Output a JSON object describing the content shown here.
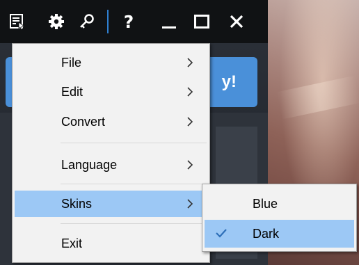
{
  "main_menu": {
    "items": [
      {
        "label": "File",
        "has_submenu": true
      },
      {
        "label": "Edit",
        "has_submenu": true
      },
      {
        "label": "Convert",
        "has_submenu": true
      },
      {
        "label": "Language",
        "has_submenu": true
      },
      {
        "label": "Skins",
        "has_submenu": true,
        "highlighted": true
      },
      {
        "label": "Exit",
        "has_submenu": false
      }
    ]
  },
  "skins_submenu": {
    "items": [
      {
        "label": "Blue",
        "checked": false
      },
      {
        "label": "Dark",
        "checked": true,
        "highlighted": true
      }
    ]
  },
  "titlebar": {
    "help_glyph": "?",
    "icons": [
      "menu-icon",
      "gear-icon",
      "key-icon",
      "help-icon",
      "minimize-icon",
      "maximize-icon",
      "close-icon"
    ]
  },
  "background_banner": {
    "visible_text": "y!"
  },
  "colors": {
    "titlebar": "#101214",
    "accent": "#2f7fd0",
    "banner": "#4a90d9",
    "menu_bg": "#f2f2f2",
    "highlight": "#9cc8f5",
    "checkmark": "#2e6fb8"
  }
}
